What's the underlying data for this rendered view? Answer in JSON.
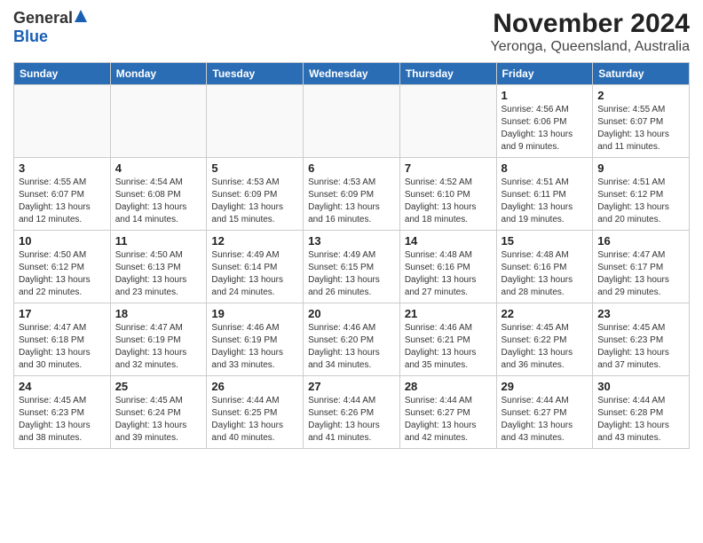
{
  "header": {
    "logo_general": "General",
    "logo_blue": "Blue",
    "main_title": "November 2024",
    "sub_title": "Yeronga, Queensland, Australia"
  },
  "calendar": {
    "weekdays": [
      "Sunday",
      "Monday",
      "Tuesday",
      "Wednesday",
      "Thursday",
      "Friday",
      "Saturday"
    ],
    "weeks": [
      [
        {
          "day": "",
          "detail": ""
        },
        {
          "day": "",
          "detail": ""
        },
        {
          "day": "",
          "detail": ""
        },
        {
          "day": "",
          "detail": ""
        },
        {
          "day": "",
          "detail": ""
        },
        {
          "day": "1",
          "detail": "Sunrise: 4:56 AM\nSunset: 6:06 PM\nDaylight: 13 hours\nand 9 minutes."
        },
        {
          "day": "2",
          "detail": "Sunrise: 4:55 AM\nSunset: 6:07 PM\nDaylight: 13 hours\nand 11 minutes."
        }
      ],
      [
        {
          "day": "3",
          "detail": "Sunrise: 4:55 AM\nSunset: 6:07 PM\nDaylight: 13 hours\nand 12 minutes."
        },
        {
          "day": "4",
          "detail": "Sunrise: 4:54 AM\nSunset: 6:08 PM\nDaylight: 13 hours\nand 14 minutes."
        },
        {
          "day": "5",
          "detail": "Sunrise: 4:53 AM\nSunset: 6:09 PM\nDaylight: 13 hours\nand 15 minutes."
        },
        {
          "day": "6",
          "detail": "Sunrise: 4:53 AM\nSunset: 6:09 PM\nDaylight: 13 hours\nand 16 minutes."
        },
        {
          "day": "7",
          "detail": "Sunrise: 4:52 AM\nSunset: 6:10 PM\nDaylight: 13 hours\nand 18 minutes."
        },
        {
          "day": "8",
          "detail": "Sunrise: 4:51 AM\nSunset: 6:11 PM\nDaylight: 13 hours\nand 19 minutes."
        },
        {
          "day": "9",
          "detail": "Sunrise: 4:51 AM\nSunset: 6:12 PM\nDaylight: 13 hours\nand 20 minutes."
        }
      ],
      [
        {
          "day": "10",
          "detail": "Sunrise: 4:50 AM\nSunset: 6:12 PM\nDaylight: 13 hours\nand 22 minutes."
        },
        {
          "day": "11",
          "detail": "Sunrise: 4:50 AM\nSunset: 6:13 PM\nDaylight: 13 hours\nand 23 minutes."
        },
        {
          "day": "12",
          "detail": "Sunrise: 4:49 AM\nSunset: 6:14 PM\nDaylight: 13 hours\nand 24 minutes."
        },
        {
          "day": "13",
          "detail": "Sunrise: 4:49 AM\nSunset: 6:15 PM\nDaylight: 13 hours\nand 26 minutes."
        },
        {
          "day": "14",
          "detail": "Sunrise: 4:48 AM\nSunset: 6:16 PM\nDaylight: 13 hours\nand 27 minutes."
        },
        {
          "day": "15",
          "detail": "Sunrise: 4:48 AM\nSunset: 6:16 PM\nDaylight: 13 hours\nand 28 minutes."
        },
        {
          "day": "16",
          "detail": "Sunrise: 4:47 AM\nSunset: 6:17 PM\nDaylight: 13 hours\nand 29 minutes."
        }
      ],
      [
        {
          "day": "17",
          "detail": "Sunrise: 4:47 AM\nSunset: 6:18 PM\nDaylight: 13 hours\nand 30 minutes."
        },
        {
          "day": "18",
          "detail": "Sunrise: 4:47 AM\nSunset: 6:19 PM\nDaylight: 13 hours\nand 32 minutes."
        },
        {
          "day": "19",
          "detail": "Sunrise: 4:46 AM\nSunset: 6:19 PM\nDaylight: 13 hours\nand 33 minutes."
        },
        {
          "day": "20",
          "detail": "Sunrise: 4:46 AM\nSunset: 6:20 PM\nDaylight: 13 hours\nand 34 minutes."
        },
        {
          "day": "21",
          "detail": "Sunrise: 4:46 AM\nSunset: 6:21 PM\nDaylight: 13 hours\nand 35 minutes."
        },
        {
          "day": "22",
          "detail": "Sunrise: 4:45 AM\nSunset: 6:22 PM\nDaylight: 13 hours\nand 36 minutes."
        },
        {
          "day": "23",
          "detail": "Sunrise: 4:45 AM\nSunset: 6:23 PM\nDaylight: 13 hours\nand 37 minutes."
        }
      ],
      [
        {
          "day": "24",
          "detail": "Sunrise: 4:45 AM\nSunset: 6:23 PM\nDaylight: 13 hours\nand 38 minutes."
        },
        {
          "day": "25",
          "detail": "Sunrise: 4:45 AM\nSunset: 6:24 PM\nDaylight: 13 hours\nand 39 minutes."
        },
        {
          "day": "26",
          "detail": "Sunrise: 4:44 AM\nSunset: 6:25 PM\nDaylight: 13 hours\nand 40 minutes."
        },
        {
          "day": "27",
          "detail": "Sunrise: 4:44 AM\nSunset: 6:26 PM\nDaylight: 13 hours\nand 41 minutes."
        },
        {
          "day": "28",
          "detail": "Sunrise: 4:44 AM\nSunset: 6:27 PM\nDaylight: 13 hours\nand 42 minutes."
        },
        {
          "day": "29",
          "detail": "Sunrise: 4:44 AM\nSunset: 6:27 PM\nDaylight: 13 hours\nand 43 minutes."
        },
        {
          "day": "30",
          "detail": "Sunrise: 4:44 AM\nSunset: 6:28 PM\nDaylight: 13 hours\nand 43 minutes."
        }
      ]
    ]
  }
}
